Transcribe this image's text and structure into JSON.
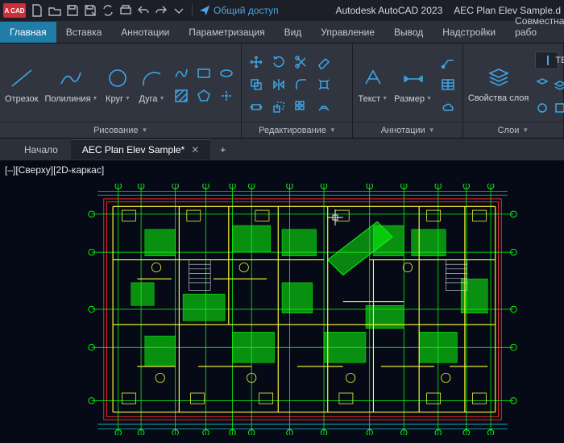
{
  "title": {
    "logo": "A CAD",
    "app": "Autodesk AutoCAD 2023",
    "file": "AEC Plan Elev Sample.d",
    "share": "Общий доступ"
  },
  "tabs": [
    "Главная",
    "Вставка",
    "Аннотации",
    "Параметризация",
    "Вид",
    "Управление",
    "Вывод",
    "Надстройки",
    "Совместная рабо"
  ],
  "active_tab": 0,
  "ribbon": {
    "draw": {
      "title": "Рисование",
      "tools": [
        "Отрезок",
        "Полилиния",
        "Круг",
        "Дуга"
      ]
    },
    "edit": {
      "title": "Редактирование"
    },
    "anno": {
      "title": "Аннотации",
      "text": "Текст",
      "dim": "Размер"
    },
    "layers": {
      "title": "Слои",
      "props": "Свойства\nслоя",
      "tex": "TEX"
    }
  },
  "doctabs": {
    "start": "Начало",
    "file": "AEC Plan Elev Sample*"
  },
  "viewport": {
    "label": "[–][Сверху][2D-каркас]"
  },
  "colors": {
    "accent": "#1f7da8",
    "stroke": "#3fa6e6",
    "plan_green": "#0cff0c",
    "plan_yellow": "#ffff3a",
    "plan_red": "#ff2a2a",
    "plan_cyan": "#1be5e5"
  }
}
